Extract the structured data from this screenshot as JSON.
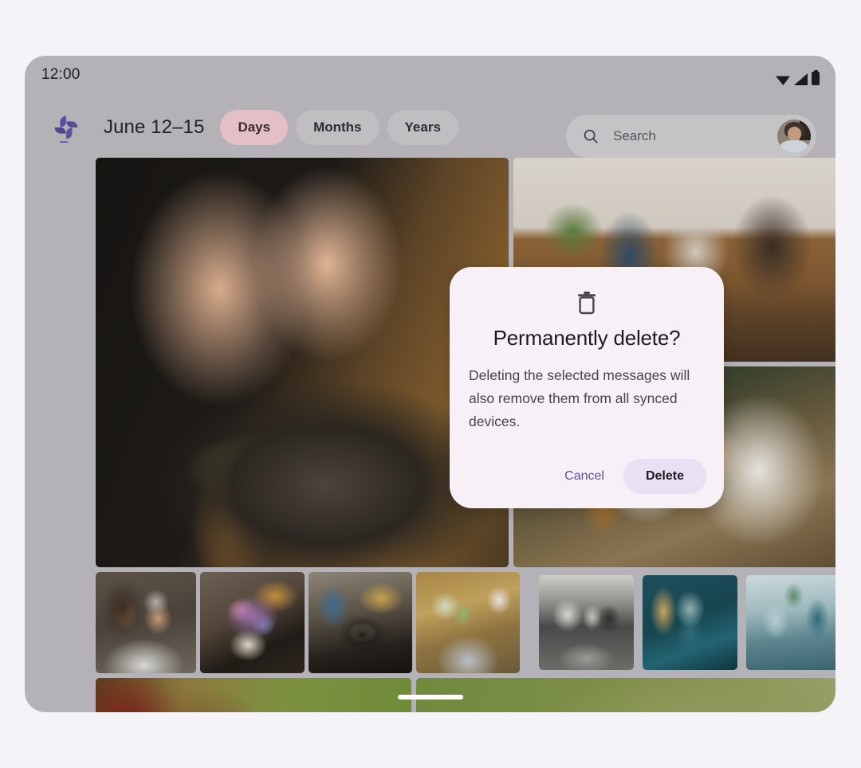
{
  "status_bar": {
    "time": "12:00",
    "icons": [
      "wifi-icon",
      "cell-signal-icon",
      "battery-icon"
    ]
  },
  "app_bar": {
    "logo": "google-photos-pinwheel-icon",
    "date_range": "June 12–15",
    "tabs": [
      {
        "label": "Days",
        "selected": true
      },
      {
        "label": "Months",
        "selected": false
      },
      {
        "label": "Years",
        "selected": false
      }
    ]
  },
  "search": {
    "icon": "search-icon",
    "placeholder": "Search",
    "value": "",
    "avatar": "account-avatar"
  },
  "grid": {
    "photos": [
      {
        "name": "photo-cooking-herbs",
        "alt": "Hands sprinkling herbs over mushrooms in a pan"
      },
      {
        "name": "photo-living-room",
        "alt": "Group of friends sitting in a living room"
      },
      {
        "name": "photo-dinner-table",
        "alt": "Person at a dinner table with bowls and a bottle"
      },
      {
        "name": "photo-couple-drinks",
        "alt": "Two people drinking at a table"
      },
      {
        "name": "photo-flowers-table",
        "alt": "Bouquet of flowers on a cluttered table"
      },
      {
        "name": "photo-pan-cooking",
        "alt": "Person cooking mushrooms in a skillet"
      },
      {
        "name": "photo-cutting-board",
        "alt": "Overhead view of a wooden cutting board"
      },
      {
        "name": "photo-bw-group",
        "alt": "Black and white photo of a group of people"
      },
      {
        "name": "photo-teal-guitar",
        "alt": "Teal-toned photo of a person with a guitar"
      },
      {
        "name": "photo-teal-room",
        "alt": "Teal-toned photo of people in a room"
      },
      {
        "name": "photo-grass-field-a",
        "alt": "Grass field"
      },
      {
        "name": "photo-grass-field-b",
        "alt": "Grass field"
      }
    ]
  },
  "dialog": {
    "icon": "trash-icon",
    "title": "Permanently delete?",
    "body": "Deleting the selected messages will also remove them from all synced devices.",
    "cancel_label": "Cancel",
    "confirm_label": "Delete"
  },
  "system_nav": {
    "handle": "gesture-navigation-handle"
  },
  "colors": {
    "page_background": "#f5f3f7",
    "device_surface": "#b4b2b6",
    "selected_chip": "#e3bfc6",
    "unselected_chip": "rgba(255,255,255,0.16)",
    "dialog_surface": "#f7f1f7",
    "confirm_button": "#e9e1f3",
    "cancel_text": "#5b4fa3",
    "logo_purple": "#5b4d9e"
  }
}
